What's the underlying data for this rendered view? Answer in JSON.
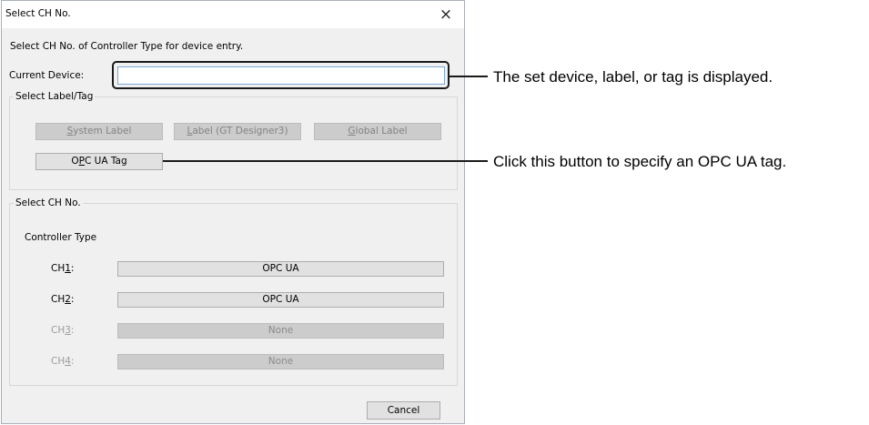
{
  "dialog": {
    "title": "Select CH No.",
    "close_glyph": "×",
    "instruction": "Select CH No. of Controller Type for device entry.",
    "current_device_label": "Current Device:",
    "current_device_value": "",
    "label_group": {
      "legend": "Select Label/Tag",
      "system_label": {
        "prefix": "",
        "key": "S",
        "rest": "ystem Label"
      },
      "gt_label": {
        "prefix": "",
        "key": "L",
        "rest": "abel (GT Designer3)"
      },
      "global_label": {
        "prefix": "",
        "key": "G",
        "rest": "lobal Label"
      },
      "opc_ua_tag": {
        "prefix": "O",
        "key": "P",
        "rest": "C UA Tag"
      }
    },
    "ch_group": {
      "legend": "Select CH No.",
      "controller_type_label": "Controller Type",
      "channels": [
        {
          "prefix": "CH",
          "key": "1",
          "suffix": ":",
          "value": "OPC UA",
          "enabled": true
        },
        {
          "prefix": "CH",
          "key": "2",
          "suffix": ":",
          "value": "OPC UA",
          "enabled": true
        },
        {
          "prefix": "CH",
          "key": "3",
          "suffix": ":",
          "value": "None",
          "enabled": false
        },
        {
          "prefix": "CH",
          "key": "4",
          "suffix": ":",
          "value": "None",
          "enabled": false
        }
      ]
    },
    "cancel_label": "Cancel"
  },
  "annotations": {
    "current_device": "The set device, label, or tag is displayed.",
    "opc_ua_button": "Click this button to specify an OPC UA tag."
  }
}
